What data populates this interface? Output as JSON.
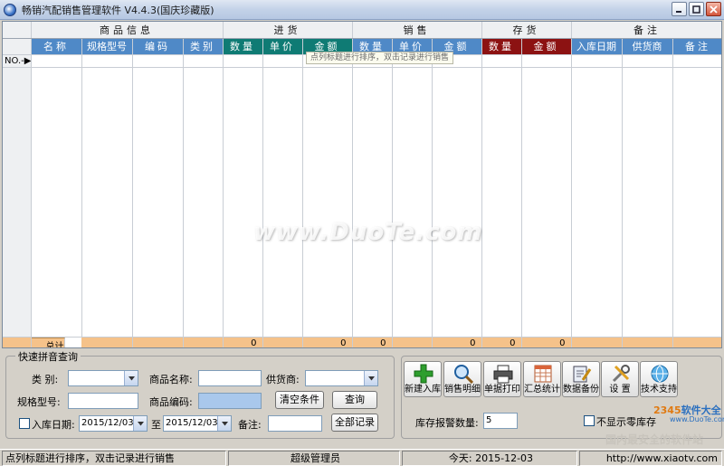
{
  "window": {
    "title": "畅销汽配销售管理软件 V4.4.3(国庆珍藏版)"
  },
  "grid": {
    "groups": [
      {
        "label": "商品信息"
      },
      {
        "label": "进货"
      },
      {
        "label": "销售"
      },
      {
        "label": "存货"
      },
      {
        "label": "备注"
      }
    ],
    "columns": [
      "名称",
      "规格型号",
      "编码",
      "类别",
      "数量",
      "单价",
      "金额",
      "数量",
      "单价",
      "金额",
      "数量",
      "金额",
      "入库日期",
      "供货商",
      "备注"
    ],
    "row_head": "NO.-▶",
    "tooltip": "点列标题进行排序，双击记录进行销售",
    "total_label": "总计",
    "totals": [
      "0",
      "0",
      "0",
      "0",
      "0",
      "0"
    ]
  },
  "watermark": "www.DuoTe.com",
  "quick_search": {
    "title": "快速拼音查询",
    "category_label": "类    别:",
    "name_label": "商品名称:",
    "supplier_label": "供货商:",
    "spec_label": "规格型号:",
    "code_label": "商品编码:",
    "clear_button": "清空条件",
    "query_button": "查询",
    "date_label": "入库日期:",
    "date_from": "2015/12/03",
    "to_label": "至",
    "date_to": "2015/12/03",
    "remark_label": "备注:",
    "all_button": "全部记录"
  },
  "toolbar": {
    "buttons": [
      {
        "label": "新建入库",
        "icon": "plus-icon"
      },
      {
        "label": "销售明细",
        "icon": "magnifier-icon"
      },
      {
        "label": "单据打印",
        "icon": "printer-icon"
      },
      {
        "label": "汇总统计",
        "icon": "spreadsheet-icon"
      },
      {
        "label": "数据备份",
        "icon": "backup-icon"
      },
      {
        "label": "设  置",
        "icon": "tools-icon"
      },
      {
        "label": "技术支持",
        "icon": "globe-icon"
      }
    ],
    "stock_alert_label": "库存报警数量:",
    "stock_alert_value": "5",
    "hide_zero_label": "不显示零库存"
  },
  "branding": {
    "logo_2345": "2345软件大全",
    "logo_prefix": "2345",
    "logo_suffix": "软件大全",
    "logo_url": "www.DuoTe.com",
    "safe_text": "国内最安全的软件站"
  },
  "status": {
    "hint": "点列标题进行排序，双击记录进行销售",
    "user": "超级管理员",
    "today": "今天: 2015-12-03",
    "website": "http://www.xiaotv.com"
  }
}
